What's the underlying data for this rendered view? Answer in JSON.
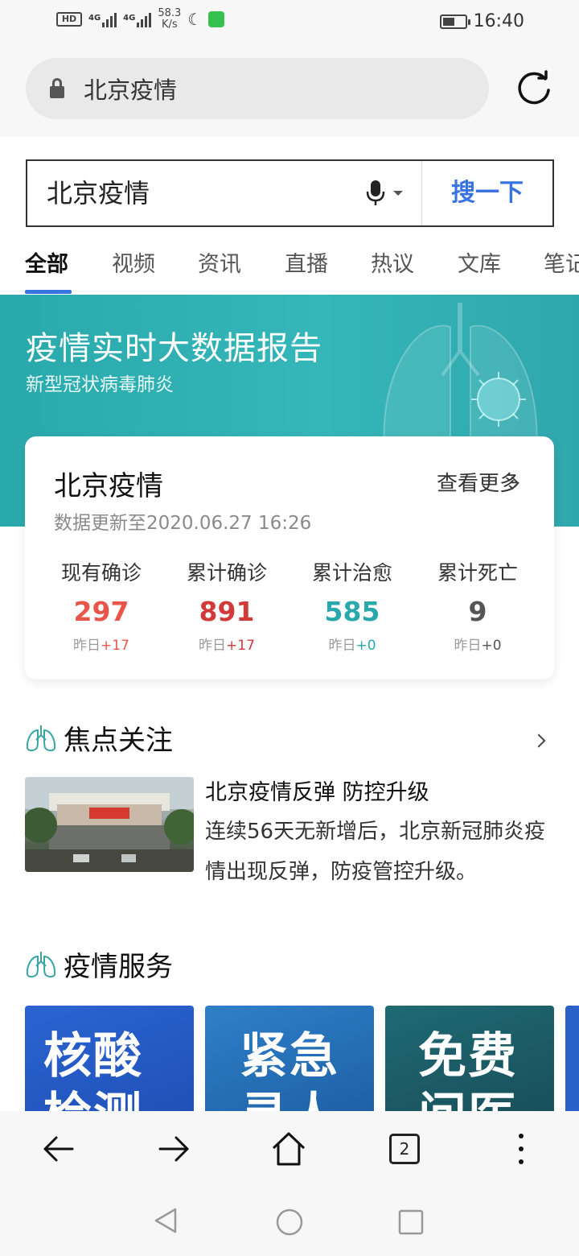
{
  "status_bar": {
    "hd": "HD",
    "network1": "4G",
    "network2": "4G",
    "speed_value": "58.3",
    "speed_unit": "K/s",
    "time": "16:40"
  },
  "address_bar": {
    "url_text": "北京疫情"
  },
  "search": {
    "query": "北京疫情",
    "button_label": "搜一下"
  },
  "tabs": [
    "全部",
    "视频",
    "资讯",
    "直播",
    "热议",
    "文库",
    "笔记"
  ],
  "banner": {
    "title": "疫情实时大数据报告",
    "subtitle": "新型冠状病毒肺炎"
  },
  "card": {
    "title": "北京疫情",
    "more_label": "查看更多",
    "update_text": "数据更新至2020.06.27 16:26",
    "stats": [
      {
        "label": "现有确诊",
        "value": "297",
        "delta_prefix": "昨日",
        "delta": "+17",
        "color": "#e8564b"
      },
      {
        "label": "累计确诊",
        "value": "891",
        "delta_prefix": "昨日",
        "delta": "+17",
        "color": "#d23a3a"
      },
      {
        "label": "累计治愈",
        "value": "585",
        "delta_prefix": "昨日",
        "delta": "+0",
        "color": "#29a9ad"
      },
      {
        "label": "累计死亡",
        "value": "9",
        "delta_prefix": "昨日",
        "delta": "+0",
        "color": "#555555"
      }
    ]
  },
  "focus": {
    "heading": "焦点关注",
    "news_title": "北京疫情反弹 防控升级",
    "news_body": "连续56天无新增后，北京新冠肺炎疫情出现反弹，防疫管控升级。"
  },
  "services": {
    "heading": "疫情服务",
    "items": [
      "核酸检测",
      "紧急寻人",
      "免费问医生"
    ]
  },
  "toolbar": {
    "tab_count": "2"
  },
  "colors": {
    "accent": "#3873e0",
    "teal": "#2fa9ad"
  }
}
